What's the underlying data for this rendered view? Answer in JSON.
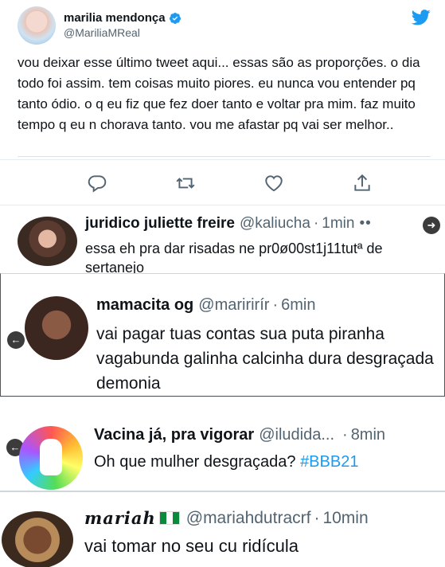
{
  "tweet": {
    "display_name": "marilia mendonça",
    "handle": "@MariliaMReal",
    "text": "vou deixar esse último tweet aqui... essas são as proporções. o dia todo foi assim. tem coisas muito piores. eu nunca vou entender pq tanto ódio. o q eu fiz que fez doer tanto e voltar pra mim. faz muito tempo q eu n chorava tanto. vou me afastar pq vai ser melhor..",
    "verified": true,
    "brand_icon": "twitter-bird-icon"
  },
  "actions": [
    {
      "icon": "reply-icon"
    },
    {
      "icon": "retweet-icon"
    },
    {
      "icon": "like-icon"
    },
    {
      "icon": "share-icon"
    }
  ],
  "replies": [
    {
      "name": "juridico juliette freire",
      "handle": "@kaliucha",
      "separator": "·",
      "time": "1min",
      "text": "essa eh pra dar risadas ne pr0ø00st1j11tutª de sertanejo",
      "more": "••"
    },
    {
      "name": "mamacita og",
      "handle": "@maririrír",
      "separator": "·",
      "time": "6min",
      "text": "vai pagar tuas contas sua puta piranha vagabunda galinha calcinha dura desgraçada demonia"
    },
    {
      "name": "Vacina já, pra vigorar",
      "handle": "@iludida...",
      "separator": "·",
      "time": "8min",
      "text": "Oh que mulher desgraçada?",
      "hashtag": "#BBB21"
    },
    {
      "name": "mariah",
      "handle": "@mariahdutracrf",
      "separator": "·",
      "time": "10min",
      "text": "vai tomar no seu cu ridícula"
    }
  ],
  "colors": {
    "accent": "#1d9bf0",
    "text": "#0f1419",
    "muted": "#536471",
    "border": "#e6ecf0"
  }
}
